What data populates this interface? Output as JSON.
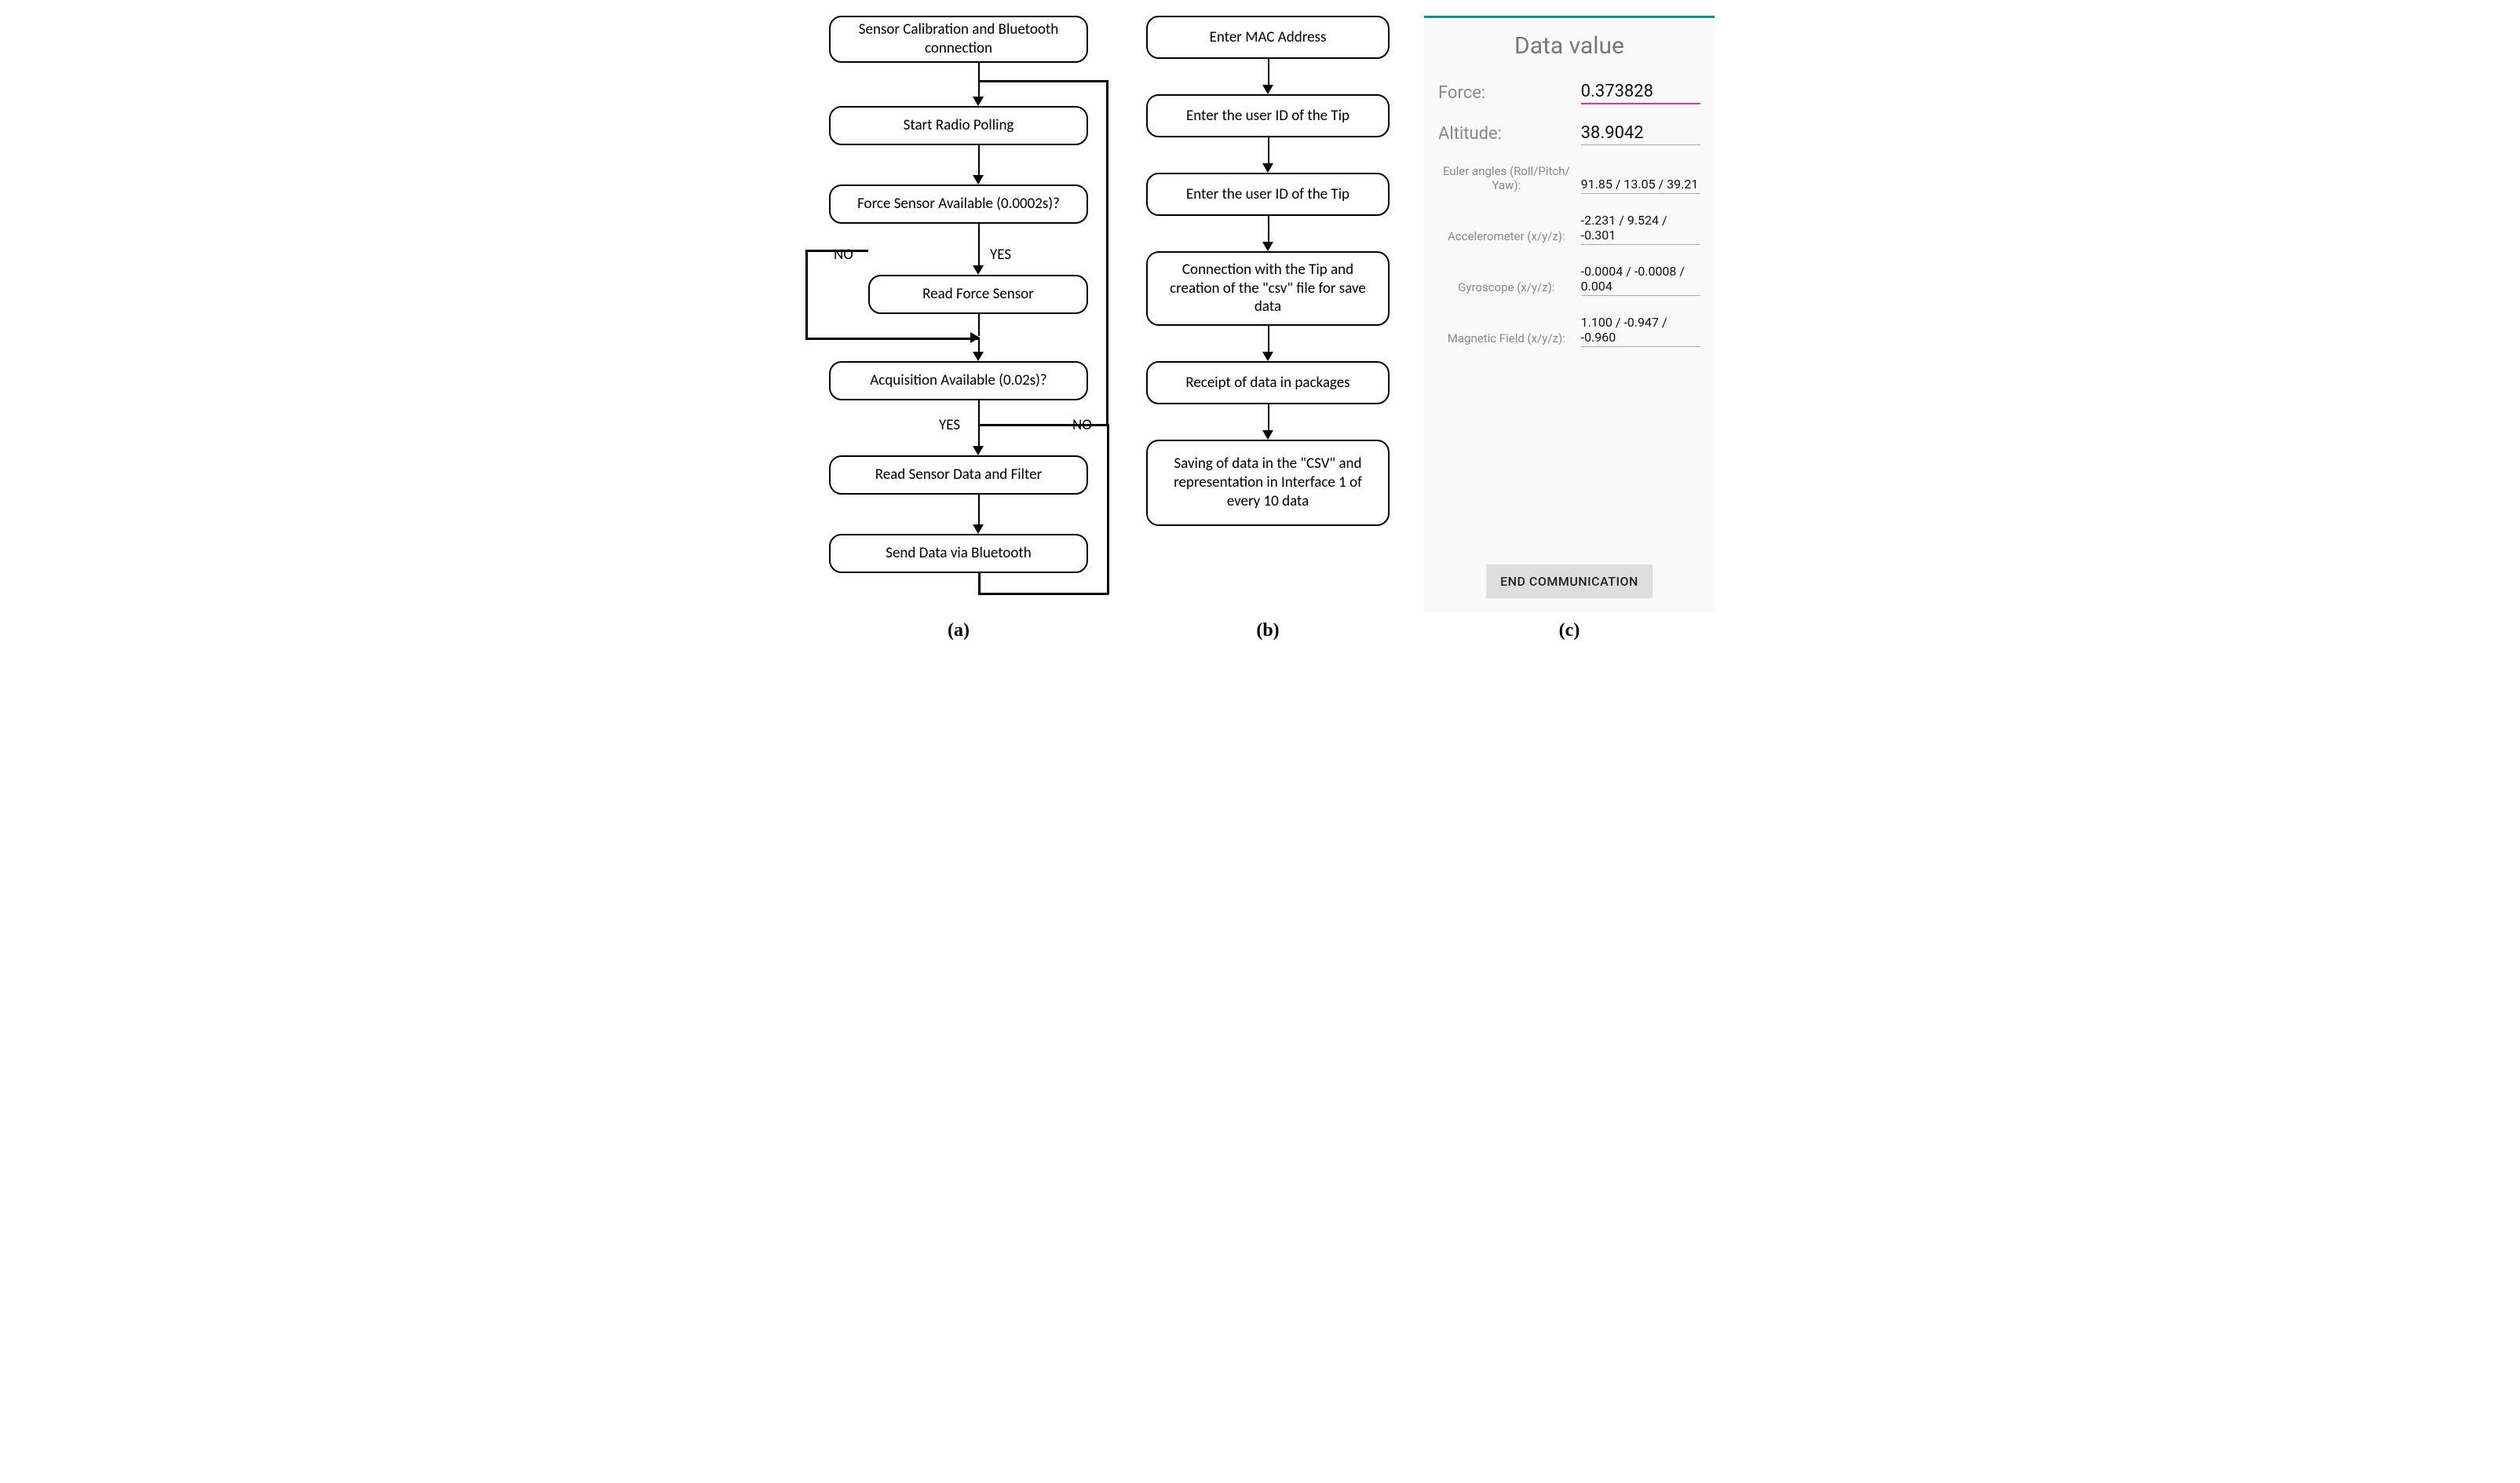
{
  "panels": {
    "a": {
      "caption": "(a)",
      "nodes": {
        "n1": "Sensor Calibration and Bluetooth connection",
        "n2": "Start Radio Polling",
        "n3": "Force Sensor Available (0.0002s)?",
        "n4": "Read Force Sensor",
        "n5": "Acquisition Available (0.02s)?",
        "n6": "Read Sensor Data and Filter",
        "n7": "Send Data via Bluetooth"
      },
      "labels": {
        "no": "NO",
        "yes": "YES"
      }
    },
    "b": {
      "caption": "(b)",
      "nodes": {
        "n1": "Enter MAC Address",
        "n2": "Enter the user ID of the Tip",
        "n3": "Enter the user ID of the Tip",
        "n4": "Connection with the Tip and creation of the \"csv\" file for save data",
        "n5": "Receipt of data in packages",
        "n6": "Saving of data in the \"CSV\" and representation in Interface 1 of every 10 data"
      }
    },
    "c": {
      "caption": "(c)",
      "title": "Data value",
      "rows": [
        {
          "label": "Force:",
          "value": "0.373828",
          "size": "big",
          "accent": true
        },
        {
          "label": "Altitude:",
          "value": "38.9042",
          "size": "big",
          "accent": false
        },
        {
          "label": "Euler angles (Roll/Pitch/\nYaw):",
          "value": "91.85 / 13.05 / 39.21",
          "size": "sm",
          "accent": false
        },
        {
          "label": "Accelerometer (x/y/z):",
          "value": "-2.231 / 9.524 / -0.301",
          "size": "sm",
          "accent": false
        },
        {
          "label": "Gyroscope (x/y/z):",
          "value": "-0.0004 / -0.0008 / 0.004",
          "size": "sm",
          "accent": false
        },
        {
          "label": "Magnetic Field (x/y/z):",
          "value": "1.100 / -0.947 / -0.960",
          "size": "sm",
          "accent": false
        }
      ],
      "button": "END COMMUNICATION"
    }
  }
}
